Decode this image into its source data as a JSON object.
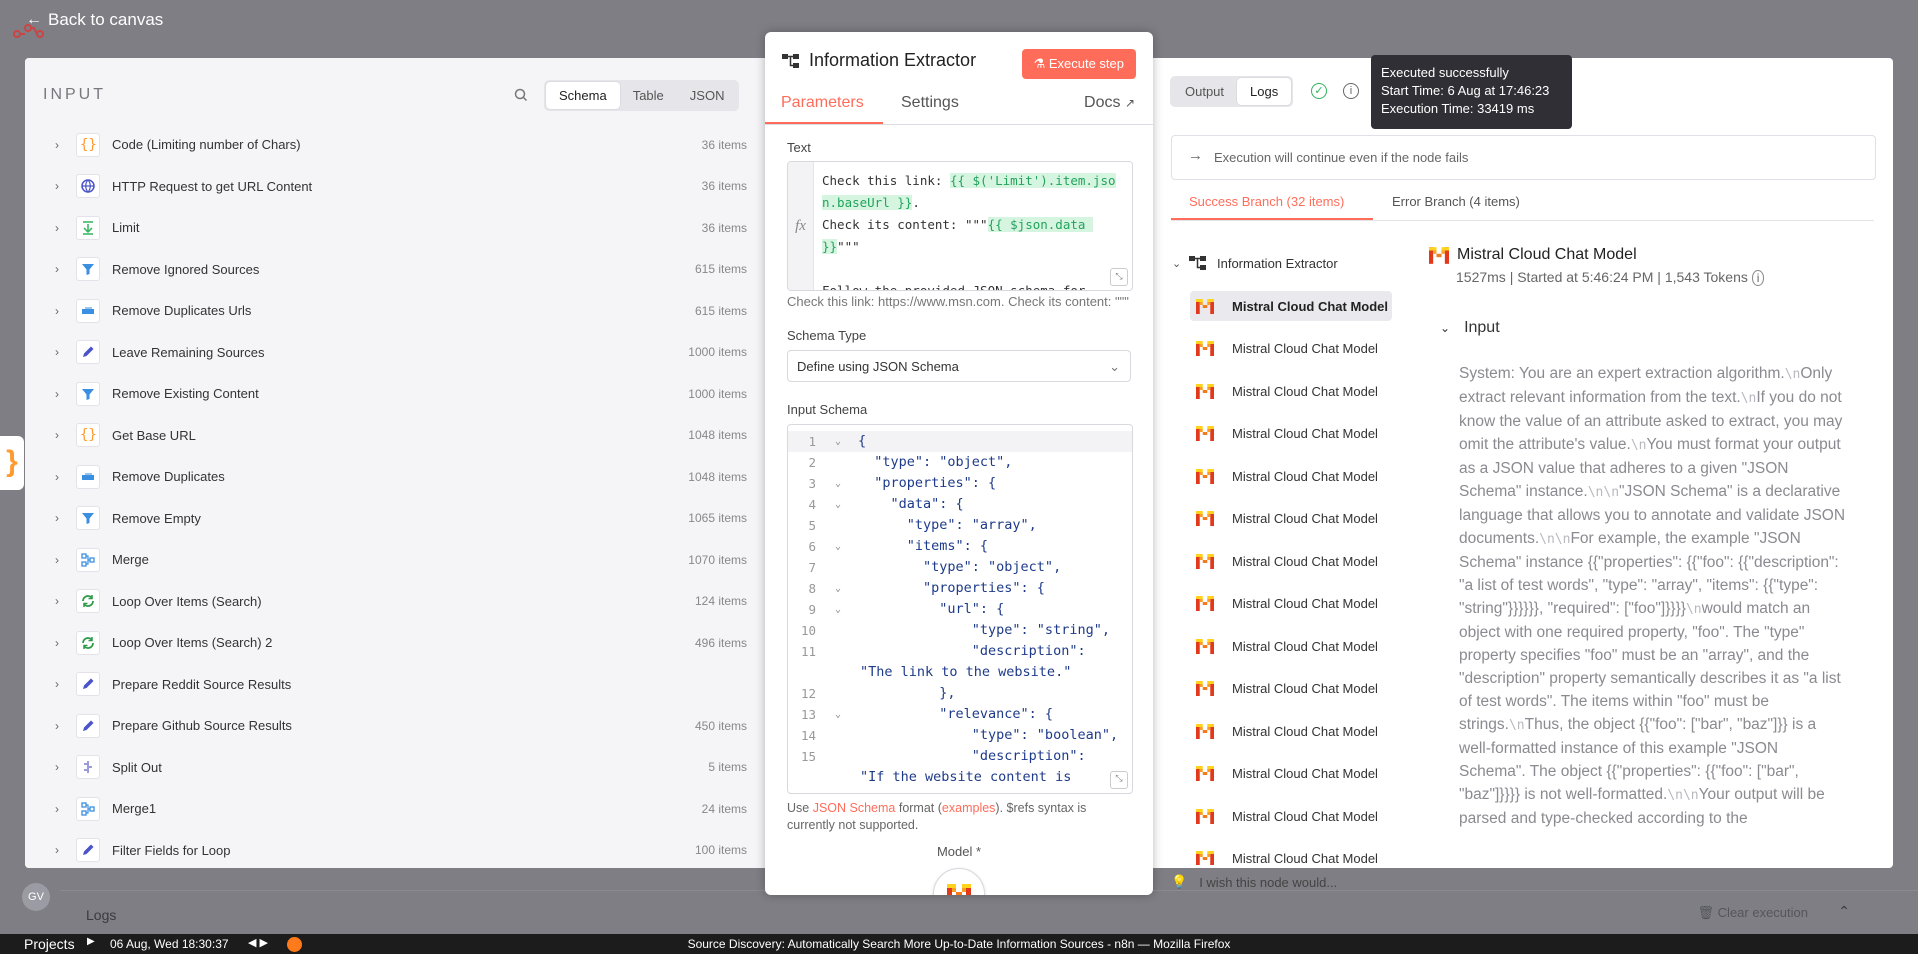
{
  "header": {
    "back_label": "Back to canvas"
  },
  "input": {
    "title": "INPUT",
    "views": [
      "Schema",
      "Table",
      "JSON"
    ],
    "active_view": "Schema",
    "items": [
      {
        "label": "Code (Limiting number of Chars)",
        "count": "36 items",
        "icon": "code-braces-icon"
      },
      {
        "label": "HTTP Request to get URL Content",
        "count": "36 items",
        "icon": "globe-icon"
      },
      {
        "label": "Limit",
        "count": "36 items",
        "icon": "limit-icon"
      },
      {
        "label": "Remove Ignored Sources",
        "count": "615 items",
        "icon": "filter-icon"
      },
      {
        "label": "Remove Duplicates Urls",
        "count": "615 items",
        "icon": "dedupe-icon"
      },
      {
        "label": "Leave Remaining Sources",
        "count": "1000 items",
        "icon": "pencil-icon"
      },
      {
        "label": "Remove Existing Content",
        "count": "1000 items",
        "icon": "filter-icon"
      },
      {
        "label": "Get Base URL",
        "count": "1048 items",
        "icon": "code-braces-icon"
      },
      {
        "label": "Remove Duplicates",
        "count": "1048 items",
        "icon": "dedupe-icon"
      },
      {
        "label": "Remove Empty",
        "count": "1065 items",
        "icon": "filter-icon"
      },
      {
        "label": "Merge",
        "count": "1070 items",
        "icon": "merge-icon"
      },
      {
        "label": "Loop Over Items (Search)",
        "count": "124 items",
        "icon": "loop-icon"
      },
      {
        "label": "Loop Over Items (Search) 2",
        "count": "496 items",
        "icon": "loop-icon"
      },
      {
        "label": "Prepare Reddit Source Results",
        "count": "",
        "icon": "pencil-icon"
      },
      {
        "label": "Prepare Github Source Results",
        "count": "450 items",
        "icon": "pencil-icon"
      },
      {
        "label": "Split Out",
        "count": "5 items",
        "icon": "split-icon"
      },
      {
        "label": "Merge1",
        "count": "24 items",
        "icon": "merge-icon"
      },
      {
        "label": "Filter Fields for Loop",
        "count": "100 items",
        "icon": "pencil-icon"
      }
    ]
  },
  "node": {
    "title": "Information Extractor",
    "execute_label": "Execute step",
    "tabs": [
      "Parameters",
      "Settings"
    ],
    "docs_label": "Docs",
    "text_label": "Text",
    "text_lines": {
      "l1_pre": "Check this link: ",
      "l1_expr": "{{ $('Limit').item.json.baseUrl }}",
      "l1_post": ".",
      "l2_pre": "Check its content: \"\"\"",
      "l2_expr": "{{ $json.data }}",
      "l2_post": "\"\"\"",
      "l3": "Follow the provided JSON schema for"
    },
    "text_preview": "Check this link: https://www.msn.com. Check its content: \"\"\"",
    "schema_type_label": "Schema Type",
    "schema_type_value": "Define using JSON Schema",
    "input_schema_label": "Input Schema",
    "schema_lines": [
      {
        "n": "1",
        "fold": true,
        "text": "{"
      },
      {
        "n": "2",
        "fold": false,
        "text": "  \"type\": \"object\","
      },
      {
        "n": "3",
        "fold": true,
        "text": "  \"properties\": {"
      },
      {
        "n": "4",
        "fold": true,
        "text": "    \"data\": {"
      },
      {
        "n": "5",
        "fold": false,
        "text": "      \"type\": \"array\","
      },
      {
        "n": "6",
        "fold": true,
        "text": "      \"items\": {"
      },
      {
        "n": "7",
        "fold": false,
        "text": "        \"type\": \"object\","
      },
      {
        "n": "8",
        "fold": true,
        "text": "        \"properties\": {"
      },
      {
        "n": "9",
        "fold": true,
        "text": "          \"url\": {"
      },
      {
        "n": "10",
        "fold": false,
        "text": "              \"type\": \"string\","
      },
      {
        "n": "11",
        "fold": false,
        "text": "              \"description\":"
      },
      {
        "n": "",
        "fold": false,
        "text": "\"The link to the website.\""
      },
      {
        "n": "12",
        "fold": false,
        "text": "          },"
      },
      {
        "n": "13",
        "fold": true,
        "text": "          \"relevance\": {"
      },
      {
        "n": "14",
        "fold": false,
        "text": "              \"type\": \"boolean\","
      },
      {
        "n": "15",
        "fold": false,
        "text": "              \"description\":"
      },
      {
        "n": "",
        "fold": false,
        "text": "\"If the website content is"
      }
    ],
    "schema_note_pre": "Use ",
    "schema_note_link": "JSON Schema",
    "schema_note_mid": " format (",
    "schema_note_link2": "examples",
    "schema_note_post": "). $refs syntax is currently not supported.",
    "model_label": "Model *"
  },
  "output": {
    "views": [
      "Output",
      "Logs"
    ],
    "active_view": "Logs",
    "tooltip": {
      "line1": "Executed successfully",
      "line2": "Start Time: 6 Aug at 17:46:23",
      "line3": "Execution Time: 33419 ms"
    },
    "continue_text": "Execution will continue even if the node fails",
    "branches": [
      "Success Branch (32 items)",
      "Error Branch (4 items)"
    ],
    "tree_root": "Information Extractor",
    "tree_items": [
      "Mistral Cloud Chat Model",
      "Mistral Cloud Chat Model",
      "Mistral Cloud Chat Model",
      "Mistral Cloud Chat Model",
      "Mistral Cloud Chat Model",
      "Mistral Cloud Chat Model",
      "Mistral Cloud Chat Model",
      "Mistral Cloud Chat Model",
      "Mistral Cloud Chat Model",
      "Mistral Cloud Chat Model",
      "Mistral Cloud Chat Model",
      "Mistral Cloud Chat Model",
      "Mistral Cloud Chat Model",
      "Mistral Cloud Chat Model"
    ],
    "detail_title": "Mistral Cloud Chat Model",
    "detail_meta": "1527ms | Started at 5:46:24 PM |    1,543 Tokens",
    "detail_input_label": "Input",
    "detail_segments": [
      "System: You are an expert extraction algorithm.",
      "Only extract relevant information from the text.",
      "If you do not know the value of an attribute asked to extract, you may omit the attribute's value.",
      "You must format your output as a JSON value that adheres to a given \"JSON Schema\" instance.",
      "\"JSON Schema\" is a declarative language that allows you to annotate and validate JSON documents.",
      "For example, the example \"JSON Schema\" instance {{\"properties\": {{\"foo\": {{\"description\": \"a list of test words\", \"type\": \"array\", \"items\": {{\"type\": \"string\"}}}}}}, \"required\": [\"foo\"]}}}}",
      "would match an object with one required property, \"foo\". The \"type\" property specifies \"foo\" must be an \"array\", and the \"description\" property semantically describes it as \"a list of test words\". The items within \"foo\" must be strings.",
      "Thus, the object {{\"foo\": [\"bar\", \"baz\"]}} is a well-formatted instance of this example \"JSON Schema\". The object {{\"properties\": {{\"foo\": [\"bar\", \"baz\"]}}}} is not well-formatted.",
      "Your output will be parsed and type-checked according to the"
    ],
    "wish_text": "I wish this node would..."
  },
  "footer": {
    "logs_label": "Logs",
    "clear_label": "Clear execution",
    "avatar_initials": "GV"
  },
  "taskbar": {
    "projects": "Projects",
    "datetime": "06 Aug, Wed 18:30:37",
    "window_title": "Source Discovery: Automatically Search More Up-to-Date Information Sources - n8n — Mozilla Firefox"
  },
  "colors": {
    "accent": "#ff6d5a",
    "success": "#2eb35c",
    "expression": "#23a35c"
  }
}
